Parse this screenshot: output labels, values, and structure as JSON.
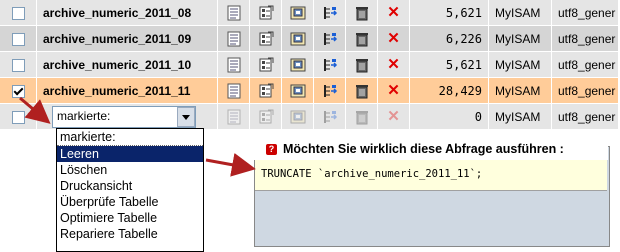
{
  "table_rows": [
    {
      "name": "archive_numeric_2011_08",
      "rows": "5,621",
      "engine": "MyISAM",
      "collation": "utf8_gener",
      "checked": false,
      "marked": false,
      "icons_faded": false,
      "style": "odd"
    },
    {
      "name": "archive_numeric_2011_09",
      "rows": "6,226",
      "engine": "MyISAM",
      "collation": "utf8_gener",
      "checked": false,
      "marked": false,
      "icons_faded": false,
      "style": "even"
    },
    {
      "name": "archive_numeric_2011_10",
      "rows": "5,621",
      "engine": "MyISAM",
      "collation": "utf8_gener",
      "checked": false,
      "marked": false,
      "icons_faded": false,
      "style": "odd"
    },
    {
      "name": "archive_numeric_2011_11",
      "rows": "28,429",
      "engine": "MyISAM",
      "collation": "utf8_gener",
      "checked": true,
      "marked": true,
      "icons_faded": false,
      "style": "marked"
    },
    {
      "name": "",
      "rows": "0",
      "engine": "MyISAM",
      "collation": "utf8_gener",
      "checked": false,
      "marked": false,
      "icons_faded": true,
      "style": "odd"
    }
  ],
  "row_icons": [
    "browse-icon",
    "structure-icon",
    "search-icon",
    "insert-icon",
    "empty-icon",
    "drop-icon"
  ],
  "with_selected": {
    "selected_value": "markierte:",
    "options": [
      "markierte:",
      "Leeren",
      "Löschen",
      "Druckansicht",
      "Überprüfe Tabelle",
      "Optimiere Tabelle",
      "Repariere Tabelle"
    ],
    "highlighted_index": 1
  },
  "confirm_dialog": {
    "title": "Möchten Sie wirklich diese Abfrage ausführen :",
    "icon_glyph": "?",
    "query": "TRUNCATE `archive_numeric_2011_11`;"
  },
  "colors": {
    "marked_row": "#ffcc99",
    "selected_option": "#0a246a",
    "drop_icon": "#e00000",
    "arrow": "#b02020"
  }
}
